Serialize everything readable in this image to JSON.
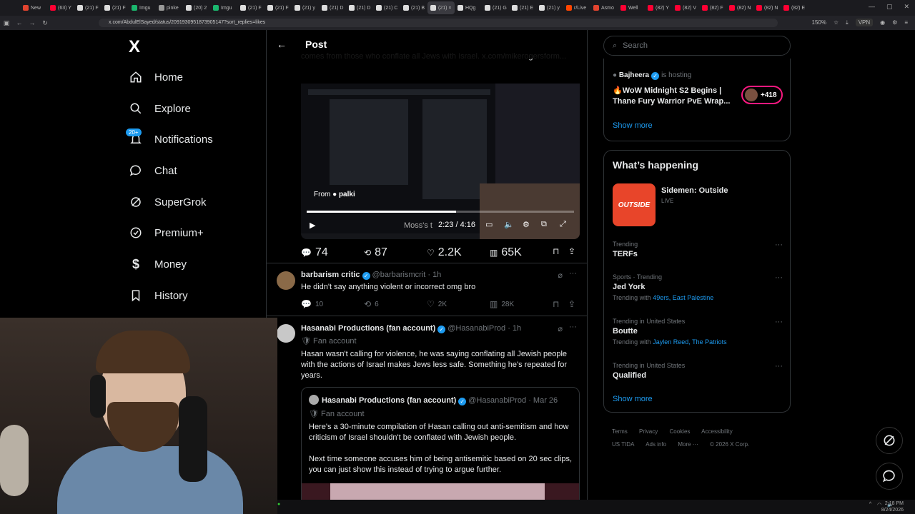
{
  "browser": {
    "tabs": [
      {
        "label": "New",
        "color": "#e2442f"
      },
      {
        "label": "(63) Y",
        "color": "#ff0033"
      },
      {
        "label": "(21) F",
        "color": "#dddddd"
      },
      {
        "label": "(21) F",
        "color": "#dddddd"
      },
      {
        "label": "Imgu",
        "color": "#1bb76e"
      },
      {
        "label": "pinke",
        "color": "#999999"
      },
      {
        "label": "(20) 2",
        "color": "#dddddd"
      },
      {
        "label": "Imgu",
        "color": "#1bb76e"
      },
      {
        "label": "(21) F",
        "color": "#dddddd"
      },
      {
        "label": "(21) F",
        "color": "#dddddd"
      },
      {
        "label": "(21) y",
        "color": "#dddddd"
      },
      {
        "label": "(21) D",
        "color": "#dddddd"
      },
      {
        "label": "(21) D",
        "color": "#dddddd"
      },
      {
        "label": "(21) C",
        "color": "#dddddd"
      },
      {
        "label": "(21) B",
        "color": "#dddddd"
      },
      {
        "label": "(21) ×",
        "color": "#dddddd",
        "active": true
      },
      {
        "label": "HQg",
        "color": "#dddddd"
      },
      {
        "label": "(21) G",
        "color": "#dddddd"
      },
      {
        "label": "(21) E",
        "color": "#dddddd"
      },
      {
        "label": "(21) y",
        "color": "#dddddd"
      },
      {
        "label": "r/Live",
        "color": "#ff4500"
      },
      {
        "label": "Asmo",
        "color": "#e2442f"
      },
      {
        "label": "Well",
        "color": "#ff0033"
      },
      {
        "label": "(82) Y",
        "color": "#ff0033"
      },
      {
        "label": "(82) V",
        "color": "#ff0033"
      },
      {
        "label": "(82) F",
        "color": "#ff0033"
      },
      {
        "label": "(82) N",
        "color": "#ff0033"
      },
      {
        "label": "(82) N",
        "color": "#ff0033"
      },
      {
        "label": "(82) E",
        "color": "#ff0033"
      }
    ],
    "url": "x.com/AbdulElSayed/status/2091930951873905147?sort_replies=likes",
    "zoom": "150%",
    "vpn": "VPN"
  },
  "nav": {
    "logo": "X",
    "items": [
      {
        "label": "Home",
        "icon": "home-icon"
      },
      {
        "label": "Explore",
        "icon": "search-icon"
      },
      {
        "label": "Notifications",
        "icon": "bell-icon",
        "badge": "20+"
      },
      {
        "label": "Chat",
        "icon": "chat-icon"
      },
      {
        "label": "SuperGrok",
        "icon": "grok-icon"
      },
      {
        "label": "Premium+",
        "icon": "verified-icon"
      },
      {
        "label": "Money",
        "icon": "money-icon"
      },
      {
        "label": "History",
        "icon": "bookmark-icon"
      }
    ]
  },
  "post": {
    "header_title": "Post",
    "quoted_text": "comes from those who conflate all Jews with Israel. x.com/mikerogersform...",
    "video": {
      "from_label": "From",
      "from_name": "palki",
      "time": "2:23 / 4:16",
      "caption": "Moss's t",
      "progress": 0.56
    },
    "stats": {
      "replies": "74",
      "reposts": "87",
      "likes": "2.2K",
      "views": "65K"
    }
  },
  "replies": [
    {
      "name": "barbarism critic",
      "handle": "@barbarismcrit",
      "time": "· 1h",
      "text": "He didn't say anything violent or incorrect omg bro",
      "stats": {
        "replies": "10",
        "reposts": "6",
        "likes": "2K",
        "views": "28K"
      }
    },
    {
      "name": "Hasanabi Productions (fan account)",
      "handle": "@HasanabiProd",
      "time": "· 1h",
      "sub": "Fan account",
      "text": "Hasan wasn't calling for violence, he was saying conflating all Jewish people with the actions of Israel makes Jews less safe. Something he's repeated for years.",
      "quote": {
        "name": "Hasanabi Productions (fan account)",
        "handle": "@HasanabiProd",
        "time": "· Mar 26",
        "sub": "Fan account",
        "text1": "Here's a 30-minute compilation of Hasan calling out anti-semitism and how criticism of Israel shouldn't be conflated with Jewish people.",
        "text2": "Next time someone accuses him of being antisemitic based on 20 sec clips, you can just show this instead of trying to argue further."
      }
    }
  ],
  "right": {
    "search_placeholder": "Search",
    "live": {
      "host": "Bajheera",
      "hosting": "is hosting",
      "title": "🔥WoW Midnight S2 Begins | Thane Fury Warrior PvE Wrap...",
      "count": "+418",
      "show_more": "Show more"
    },
    "happening": {
      "title": "What’s happening",
      "event": {
        "name": "Sidemen: Outside",
        "status": "LIVE",
        "thumb_text": "OUTSIDE"
      },
      "trends": [
        {
          "context": "Trending",
          "name": "TERFs",
          "with": "",
          "links": ""
        },
        {
          "context": "Sports · Trending",
          "name": "Jed York",
          "with": "Trending with",
          "links": "49ers, East Palestine"
        },
        {
          "context": "Trending in United States",
          "name": "Boutte",
          "with": "Trending with",
          "links": "Jaylen Reed, The Patriots"
        },
        {
          "context": "Trending in United States",
          "name": "Qualified",
          "with": "",
          "links": ""
        }
      ],
      "show_more": "Show more"
    },
    "footer": {
      "line1": [
        "Terms",
        "Privacy",
        "Cookies",
        "Accessibility"
      ],
      "line2": [
        "US TIDA",
        "Ads info",
        "More ···",
        "© 2026 X Corp."
      ]
    }
  },
  "taskbar": {
    "time": "2:18 PM",
    "date": "8/24/2026"
  }
}
